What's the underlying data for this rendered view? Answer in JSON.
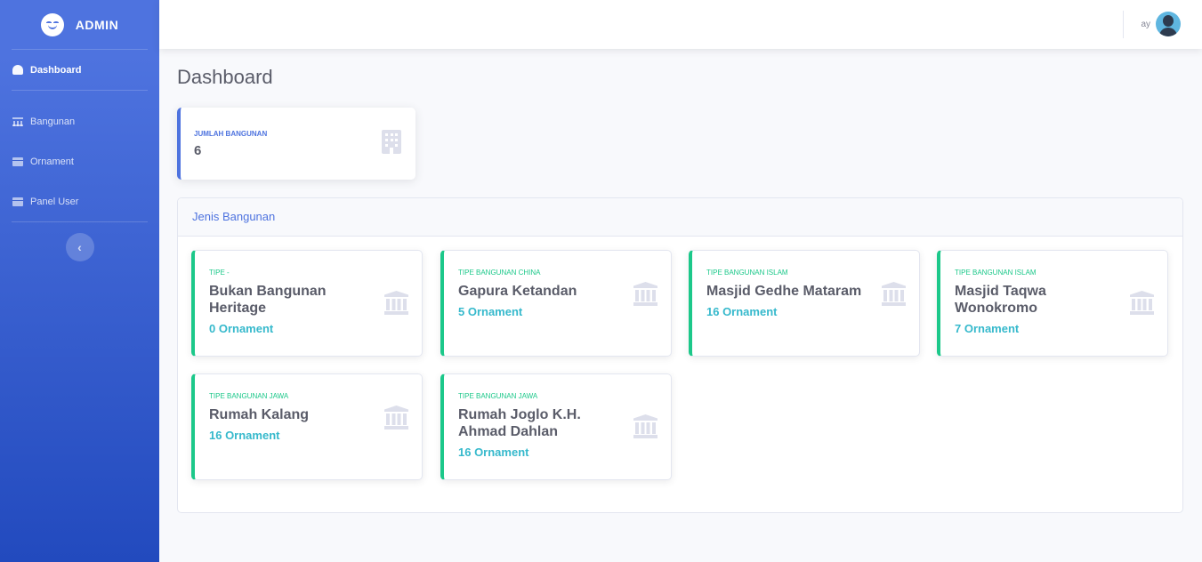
{
  "brand": {
    "name": "ADMIN"
  },
  "sidebar": {
    "items": [
      {
        "label": "Dashboard",
        "icon": "tachometer-icon"
      },
      {
        "label": "Bangunan",
        "icon": "bank-icon"
      },
      {
        "label": "Ornament",
        "icon": "archive-icon"
      },
      {
        "label": "Panel User",
        "icon": "archive-icon"
      }
    ],
    "toggle_glyph": "‹"
  },
  "topbar": {
    "user_name": "ay"
  },
  "page": {
    "title": "Dashboard"
  },
  "stat": {
    "label": "JUMLAH BANGUNAN",
    "value": "6"
  },
  "panel": {
    "title": "Jenis Bangunan",
    "cards": [
      {
        "tipe": "TIPE -",
        "title": "Bukan Bangunan Heritage",
        "count": "0 Ornament"
      },
      {
        "tipe": "TIPE BANGUNAN CHINA",
        "title": "Gapura Ketandan",
        "count": "5 Ornament"
      },
      {
        "tipe": "TIPE BANGUNAN ISLAM",
        "title": "Masjid Gedhe Mataram",
        "count": "16 Ornament"
      },
      {
        "tipe": "TIPE BANGUNAN ISLAM",
        "title": "Masjid Taqwa Wonokromo",
        "count": "7 Ornament"
      },
      {
        "tipe": "TIPE BANGUNAN JAWA",
        "title": "Rumah Kalang",
        "count": "16 Ornament"
      },
      {
        "tipe": "TIPE BANGUNAN JAWA",
        "title": "Rumah Joglo K.H. Ahmad Dahlan",
        "count": "16 Ornament"
      }
    ]
  },
  "colors": {
    "primary": "#4e73df",
    "success": "#1cc88a",
    "info": "#36b9cc"
  }
}
